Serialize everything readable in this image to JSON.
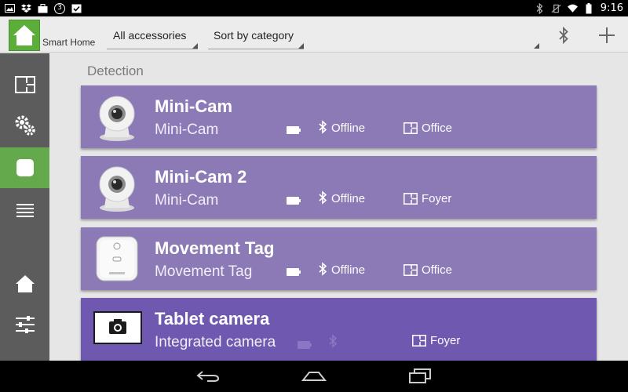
{
  "status_bar": {
    "notification_count": "3",
    "time": "9:16",
    "icons": [
      "image-icon",
      "dropbox-icon",
      "notification-count-badge",
      "clipboard-check-icon",
      "bluetooth-icon",
      "vibrate-icon",
      "wifi-icon",
      "battery-icon"
    ]
  },
  "action_bar": {
    "app_title": "Smart Home",
    "filter_label": "All accessories",
    "sort_label": "Sort by category",
    "icons": [
      "home-logo-icon",
      "bluetooth-icon",
      "plus-icon"
    ]
  },
  "left_nav": {
    "items": [
      {
        "name": "rooms",
        "icon": "floor-plan-icon",
        "active": false
      },
      {
        "name": "settings",
        "icon": "gears-icon",
        "active": false
      },
      {
        "name": "accessories",
        "icon": "device-icon",
        "active": true
      },
      {
        "name": "list",
        "icon": "list-icon",
        "active": false
      },
      {
        "name": "home",
        "icon": "home-icon",
        "active": false
      },
      {
        "name": "controls",
        "icon": "sliders-icon",
        "active": false
      }
    ]
  },
  "main": {
    "section_title": "Detection",
    "cards": [
      {
        "name": "Mini-Cam",
        "subtitle": "Mini-Cam",
        "status": "Offline",
        "room": "Office",
        "thumb": "webcam-icon",
        "selected": false
      },
      {
        "name": "Mini-Cam 2",
        "subtitle": "Mini-Cam",
        "status": "Offline",
        "room": "Foyer",
        "thumb": "webcam-icon",
        "selected": false
      },
      {
        "name": "Movement Tag",
        "subtitle": "Movement Tag",
        "status": "Offline",
        "room": "Office",
        "thumb": "movement-tag-icon",
        "selected": false
      },
      {
        "name": "Tablet camera",
        "subtitle": "Integrated camera",
        "status": "",
        "room": "Foyer",
        "thumb": "tablet-camera-icon",
        "selected": true
      }
    ]
  },
  "nav_bar": {
    "icons": [
      "back-icon",
      "home-icon",
      "recents-icon"
    ]
  },
  "colors": {
    "accent_green": "#64a94b",
    "card_purple": "#8c7ab7",
    "card_purple_selected": "#6f58b0",
    "nav_gray": "#5c5c5c"
  }
}
